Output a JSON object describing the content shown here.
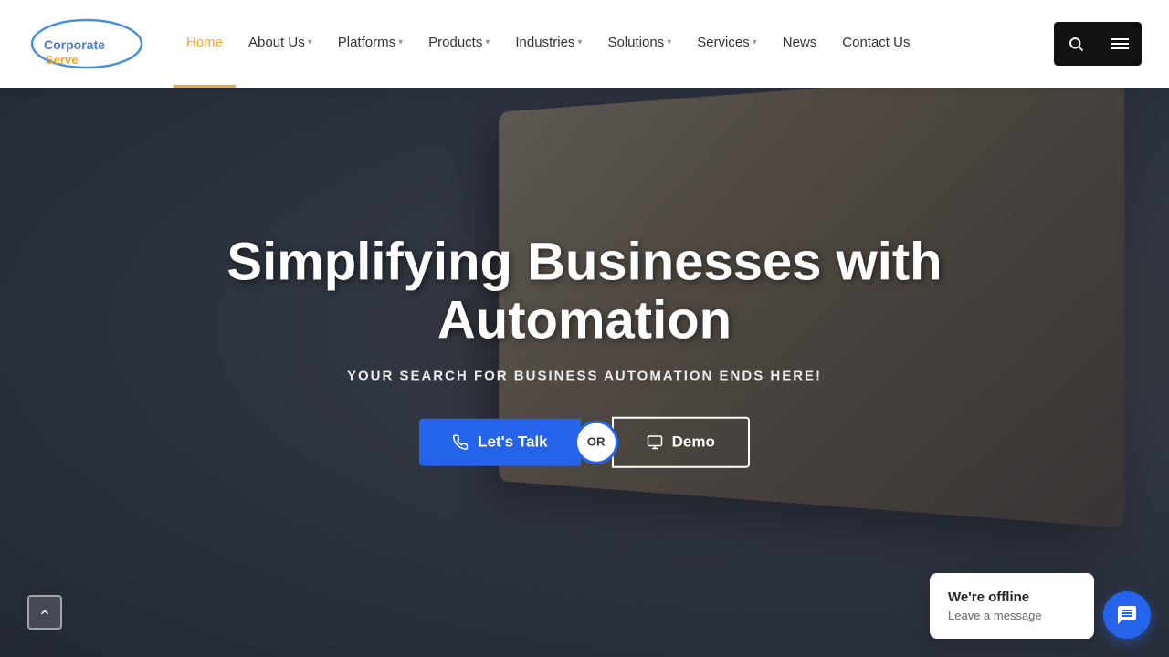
{
  "brand": {
    "name": "CorporateServe",
    "logo_text_corp": "Corporate",
    "logo_text_serve": "Serve"
  },
  "nav": {
    "home_label": "Home",
    "about_label": "About Us",
    "platforms_label": "Platforms",
    "products_label": "Products",
    "industries_label": "Industries",
    "solutions_label": "Solutions",
    "services_label": "Services",
    "news_label": "News",
    "contact_label": "Contact Us"
  },
  "hero": {
    "title": "Simplifying Businesses with Automation",
    "subtitle": "YOUR SEARCH FOR BUSINESS AUTOMATION ENDS HERE!",
    "btn_talk": "Let's Talk",
    "btn_or": "OR",
    "btn_demo": "Demo"
  },
  "chat": {
    "status": "We're offline",
    "cta": "Leave a message"
  }
}
